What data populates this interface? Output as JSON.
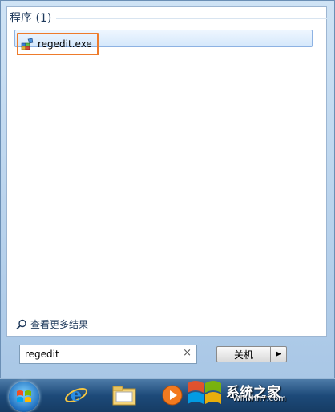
{
  "start_menu": {
    "section_header": "程序 (1)",
    "result_label": "regedit.exe",
    "more_results": "查看更多结果",
    "search_value": "regedit",
    "clear_glyph": "×",
    "shutdown_label": "关机",
    "shutdown_arrow": "▶"
  },
  "watermark": {
    "title": "系统之家",
    "site": "Winwin7.com"
  },
  "icons": [
    "registry-editor-icon",
    "search-icon",
    "clear-icon",
    "windows-orb-icon",
    "internet-explorer-icon",
    "file-explorer-icon",
    "media-player-icon"
  ],
  "colors": {
    "highlight_border": "#ee7b2b",
    "taskbar": "#1d4a79",
    "selected_result": "#d5e8fb"
  }
}
